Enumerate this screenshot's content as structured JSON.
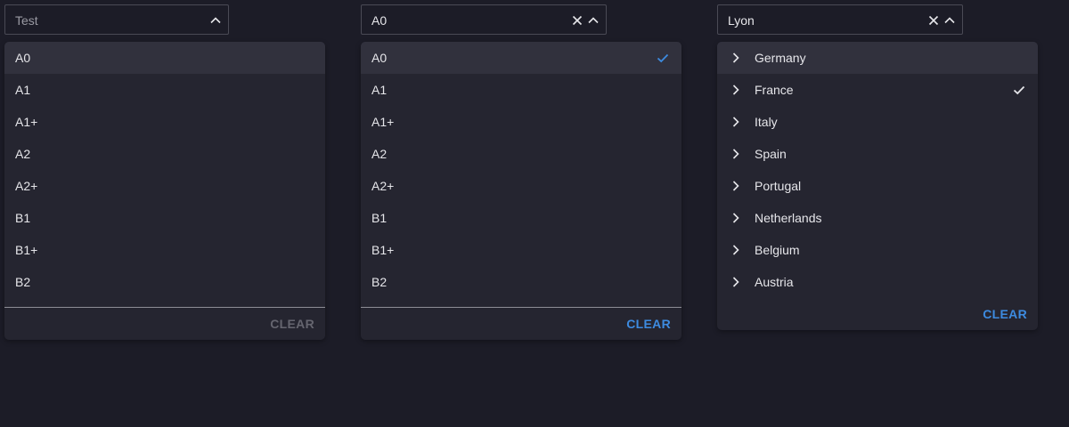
{
  "colors": {
    "background": "#1c1c27",
    "panel": "#252530",
    "highlight": "#31313d",
    "accent": "#3d8be0",
    "check_blue": "#3d8be0",
    "check_white": "#e6e6ea",
    "clear_disabled": "#65656f"
  },
  "select1": {
    "placeholder": "Test",
    "arrow_icon": "chevron-up-icon",
    "options": [
      "A0",
      "A1",
      "A1+",
      "A2",
      "A2+",
      "B1",
      "B1+",
      "B2"
    ],
    "highlighted": "A0",
    "clear_label": "CLEAR",
    "clear_enabled": false
  },
  "select2": {
    "value": "A0",
    "clear_icon": "close-icon",
    "arrow_icon": "chevron-up-icon",
    "options": [
      "A0",
      "A1",
      "A1+",
      "A2",
      "A2+",
      "B1",
      "B1+",
      "B2"
    ],
    "highlighted": "A0",
    "selected": "A0",
    "check_icon": "check-icon",
    "clear_label": "CLEAR",
    "clear_enabled": true
  },
  "select3": {
    "value": "Lyon",
    "clear_icon": "close-icon",
    "arrow_icon": "chevron-up-icon",
    "options": [
      "Germany",
      "France",
      "Italy",
      "Spain",
      "Portugal",
      "Netherlands",
      "Belgium",
      "Austria"
    ],
    "expand_icon": "chevron-right-icon",
    "highlighted": "Germany",
    "selected": "France",
    "check_icon": "check-icon",
    "clear_label": "CLEAR",
    "clear_enabled": true
  }
}
